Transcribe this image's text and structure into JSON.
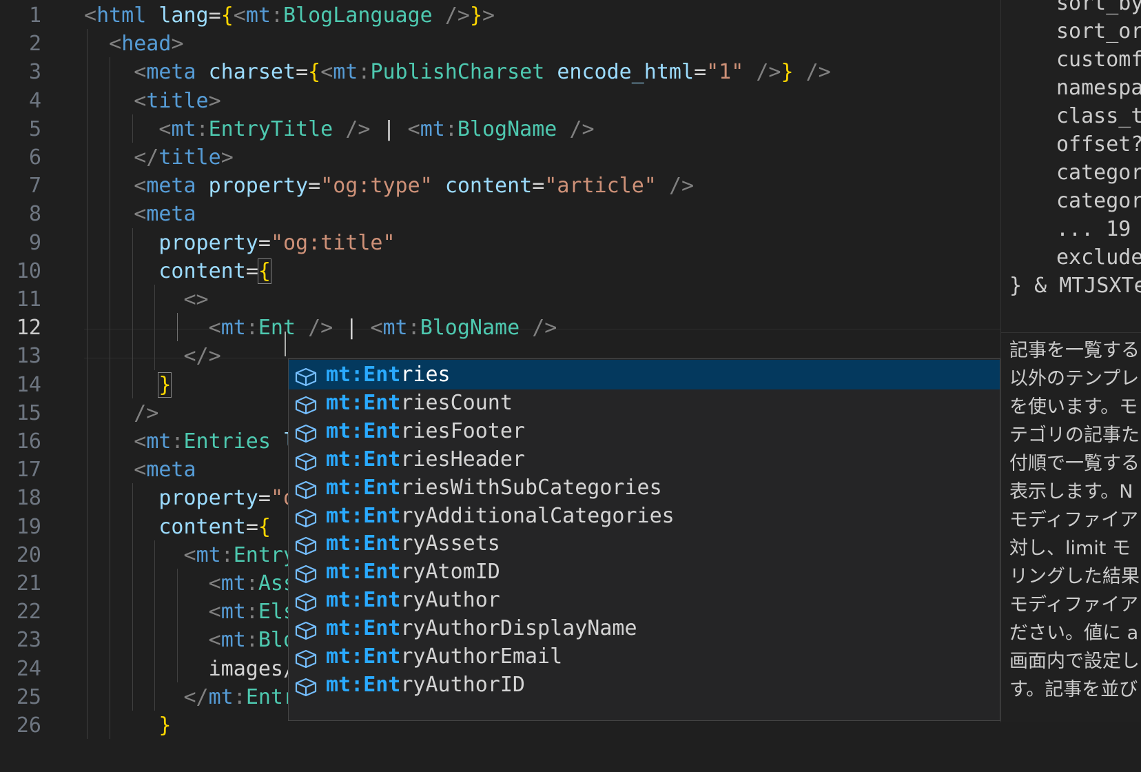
{
  "gutter": {
    "line_numbers": [
      "1",
      "2",
      "3",
      "4",
      "5",
      "6",
      "7",
      "8",
      "9",
      "10",
      "11",
      "12",
      "13",
      "14",
      "15",
      "16",
      "17",
      "18",
      "19",
      "20",
      "21",
      "22",
      "23",
      "24",
      "25",
      "26"
    ],
    "active_line": "12"
  },
  "code_lines": [
    [
      [
        "t-punc",
        "<"
      ],
      [
        "t-tag",
        "html"
      ],
      [
        "t-text",
        " "
      ],
      [
        "t-attr",
        "lang"
      ],
      [
        "t-text",
        "="
      ],
      [
        "t-brace",
        "{"
      ],
      [
        "t-punc",
        "<"
      ],
      [
        "t-tag",
        "mt"
      ],
      [
        "t-punc",
        ":"
      ],
      [
        "t-comp",
        "BlogLanguage"
      ],
      [
        "t-text",
        " "
      ],
      [
        "t-punc",
        "/>"
      ],
      [
        "t-brace",
        "}"
      ],
      [
        "t-punc",
        ">"
      ]
    ],
    [
      [
        "t-text",
        "  "
      ],
      [
        "t-punc",
        "<"
      ],
      [
        "t-tag",
        "head"
      ],
      [
        "t-punc",
        ">"
      ]
    ],
    [
      [
        "t-text",
        "    "
      ],
      [
        "t-punc",
        "<"
      ],
      [
        "t-tag",
        "meta"
      ],
      [
        "t-text",
        " "
      ],
      [
        "t-attr",
        "charset"
      ],
      [
        "t-text",
        "="
      ],
      [
        "t-brace",
        "{"
      ],
      [
        "t-punc",
        "<"
      ],
      [
        "t-tag",
        "mt"
      ],
      [
        "t-punc",
        ":"
      ],
      [
        "t-comp",
        "PublishCharset"
      ],
      [
        "t-text",
        " "
      ],
      [
        "t-attr",
        "encode_html"
      ],
      [
        "t-text",
        "="
      ],
      [
        "t-str",
        "\"1\""
      ],
      [
        "t-text",
        " "
      ],
      [
        "t-punc",
        "/>"
      ],
      [
        "t-brace",
        "}"
      ],
      [
        "t-text",
        " "
      ],
      [
        "t-punc",
        "/>"
      ]
    ],
    [
      [
        "t-text",
        "    "
      ],
      [
        "t-punc",
        "<"
      ],
      [
        "t-tag",
        "title"
      ],
      [
        "t-punc",
        ">"
      ]
    ],
    [
      [
        "t-text",
        "      "
      ],
      [
        "t-punc",
        "<"
      ],
      [
        "t-tag",
        "mt"
      ],
      [
        "t-punc",
        ":"
      ],
      [
        "t-comp",
        "EntryTitle"
      ],
      [
        "t-text",
        " "
      ],
      [
        "t-punc",
        "/>"
      ],
      [
        "t-text",
        " | "
      ],
      [
        "t-punc",
        "<"
      ],
      [
        "t-tag",
        "mt"
      ],
      [
        "t-punc",
        ":"
      ],
      [
        "t-comp",
        "BlogName"
      ],
      [
        "t-text",
        " "
      ],
      [
        "t-punc",
        "/>"
      ]
    ],
    [
      [
        "t-text",
        "    "
      ],
      [
        "t-punc",
        "</"
      ],
      [
        "t-tag",
        "title"
      ],
      [
        "t-punc",
        ">"
      ]
    ],
    [
      [
        "t-text",
        "    "
      ],
      [
        "t-punc",
        "<"
      ],
      [
        "t-tag",
        "meta"
      ],
      [
        "t-text",
        " "
      ],
      [
        "t-attr",
        "property"
      ],
      [
        "t-text",
        "="
      ],
      [
        "t-str",
        "\"og:type\""
      ],
      [
        "t-text",
        " "
      ],
      [
        "t-attr",
        "content"
      ],
      [
        "t-text",
        "="
      ],
      [
        "t-str",
        "\"article\""
      ],
      [
        "t-text",
        " "
      ],
      [
        "t-punc",
        "/>"
      ]
    ],
    [
      [
        "t-text",
        "    "
      ],
      [
        "t-punc",
        "<"
      ],
      [
        "t-tag",
        "meta"
      ]
    ],
    [
      [
        "t-text",
        "      "
      ],
      [
        "t-attr",
        "property"
      ],
      [
        "t-text",
        "="
      ],
      [
        "t-str",
        "\"og:title\""
      ]
    ],
    [
      [
        "t-text",
        "      "
      ],
      [
        "t-attr",
        "content"
      ],
      [
        "t-text",
        "="
      ],
      [
        "t-brace t-cursor",
        "{"
      ]
    ],
    [
      [
        "t-text",
        "        "
      ],
      [
        "t-punc",
        "<>"
      ]
    ],
    [
      [
        "t-text",
        "          "
      ],
      [
        "t-punc",
        "<"
      ],
      [
        "t-tag",
        "mt"
      ],
      [
        "t-punc",
        ":"
      ],
      [
        "t-comp",
        "Ent"
      ],
      [
        "t-text",
        " "
      ],
      [
        "t-punc",
        "/>"
      ],
      [
        "t-text",
        " | "
      ],
      [
        "t-punc",
        "<"
      ],
      [
        "t-tag",
        "mt"
      ],
      [
        "t-punc",
        ":"
      ],
      [
        "t-comp",
        "BlogName"
      ],
      [
        "t-text",
        " "
      ],
      [
        "t-punc",
        "/>"
      ]
    ],
    [
      [
        "t-text",
        "        "
      ],
      [
        "t-punc",
        "</>"
      ]
    ],
    [
      [
        "t-text",
        "      "
      ],
      [
        "t-brace t-cursor",
        "}"
      ]
    ],
    [
      [
        "t-text",
        "    "
      ],
      [
        "t-punc",
        "/>"
      ]
    ],
    [
      [
        "t-text",
        "    "
      ],
      [
        "t-punc",
        "<"
      ],
      [
        "t-tag",
        "mt"
      ],
      [
        "t-punc",
        ":"
      ],
      [
        "t-comp",
        "Entries"
      ],
      [
        "t-text",
        " "
      ],
      [
        "t-attr",
        "l"
      ]
    ],
    [
      [
        "t-text",
        "    "
      ],
      [
        "t-punc",
        "<"
      ],
      [
        "t-tag",
        "meta"
      ]
    ],
    [
      [
        "t-text",
        "      "
      ],
      [
        "t-attr",
        "property"
      ],
      [
        "t-text",
        "="
      ],
      [
        "t-str",
        "\"o"
      ]
    ],
    [
      [
        "t-text",
        "      "
      ],
      [
        "t-attr",
        "content"
      ],
      [
        "t-text",
        "="
      ],
      [
        "t-brace",
        "{"
      ]
    ],
    [
      [
        "t-text",
        "        "
      ],
      [
        "t-punc",
        "<"
      ],
      [
        "t-tag",
        "mt"
      ],
      [
        "t-punc",
        ":"
      ],
      [
        "t-comp",
        "Entry"
      ]
    ],
    [
      [
        "t-text",
        "          "
      ],
      [
        "t-punc",
        "<"
      ],
      [
        "t-tag",
        "mt"
      ],
      [
        "t-punc",
        ":"
      ],
      [
        "t-comp",
        "Ass"
      ]
    ],
    [
      [
        "t-text",
        "          "
      ],
      [
        "t-punc",
        "<"
      ],
      [
        "t-tag",
        "mt"
      ],
      [
        "t-punc",
        ":"
      ],
      [
        "t-comp",
        "Els"
      ]
    ],
    [
      [
        "t-text",
        "          "
      ],
      [
        "t-punc",
        "<"
      ],
      [
        "t-tag",
        "mt"
      ],
      [
        "t-punc",
        ":"
      ],
      [
        "t-comp",
        "Blo"
      ]
    ],
    [
      [
        "t-text",
        "          images/"
      ]
    ],
    [
      [
        "t-text",
        "        "
      ],
      [
        "t-punc",
        "</"
      ],
      [
        "t-tag",
        "mt"
      ],
      [
        "t-punc",
        ":"
      ],
      [
        "t-comp",
        "EntryAssets"
      ],
      [
        "t-punc",
        ">"
      ]
    ],
    [
      [
        "t-text",
        "      "
      ],
      [
        "t-brace",
        "}"
      ]
    ]
  ],
  "suggest": {
    "typed_prefix": "mt:Ent",
    "selected_index": 0,
    "items": [
      {
        "match": "mt:Ent",
        "rest": "ries"
      },
      {
        "match": "mt:Ent",
        "rest": "riesCount"
      },
      {
        "match": "mt:Ent",
        "rest": "riesFooter"
      },
      {
        "match": "mt:Ent",
        "rest": "riesHeader"
      },
      {
        "match": "mt:Ent",
        "rest": "riesWithSubCategories"
      },
      {
        "match": "mt:Ent",
        "rest": "ryAdditionalCategories"
      },
      {
        "match": "mt:Ent",
        "rest": "ryAssets"
      },
      {
        "match": "mt:Ent",
        "rest": "ryAtomID"
      },
      {
        "match": "mt:Ent",
        "rest": "ryAuthor"
      },
      {
        "match": "mt:Ent",
        "rest": "ryAuthorDisplayName"
      },
      {
        "match": "mt:Ent",
        "rest": "ryAuthorEmail"
      },
      {
        "match": "mt:Ent",
        "rest": "ryAuthorID"
      }
    ],
    "item_icon": "symbol-component-icon"
  },
  "details": {
    "signature_lines": [
      "sort_by",
      "sort_or",
      "customf",
      "namespa",
      "class_t",
      "offset?",
      "categor",
      "categor",
      "... 19",
      "exclude",
      "} & MTJSXTe"
    ],
    "doc_lines": [
      "記事を一覧する",
      "以外のテンプレ",
      "を使います。モ",
      "テゴリの記事た",
      "付順で一覧する",
      "表示します。N",
      "モディファイア",
      "対し、limit モ",
      "リングした結果",
      "モディファイア",
      "ださい。値に a",
      "画面内で設定し",
      "す。記事を並び"
    ]
  },
  "colors": {
    "background": "#1f1f1f",
    "suggest_background": "#252526",
    "suggest_selected": "#04395e",
    "match_highlight": "#2aaaff",
    "tag": "#569cd6",
    "component": "#4ec9b0",
    "attribute": "#9cdcfe",
    "string": "#ce9178",
    "brace": "#ffd700"
  }
}
